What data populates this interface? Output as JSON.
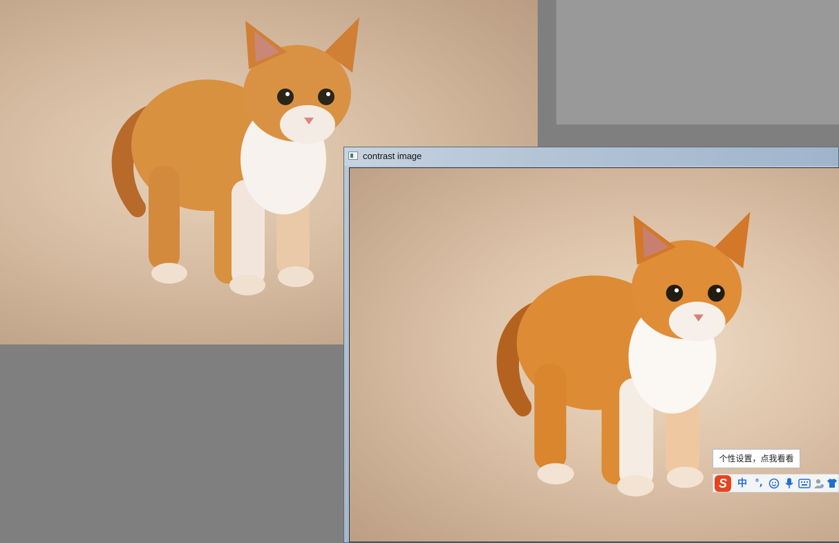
{
  "window": {
    "title": "contrast image"
  },
  "ime": {
    "tooltip": "个性设置，点我看看",
    "logo": "S",
    "mode_label": "中",
    "punct_label": "°,",
    "icons": [
      "emoji-icon",
      "microphone-icon",
      "keyboard-icon",
      "user-icon",
      "skin-shirt-icon"
    ]
  },
  "colors": {
    "desktop": "#7f7f7f",
    "gray_panel": "#999999",
    "ime_logo": "#e8431f",
    "ime_accent": "#1f6fcf"
  }
}
